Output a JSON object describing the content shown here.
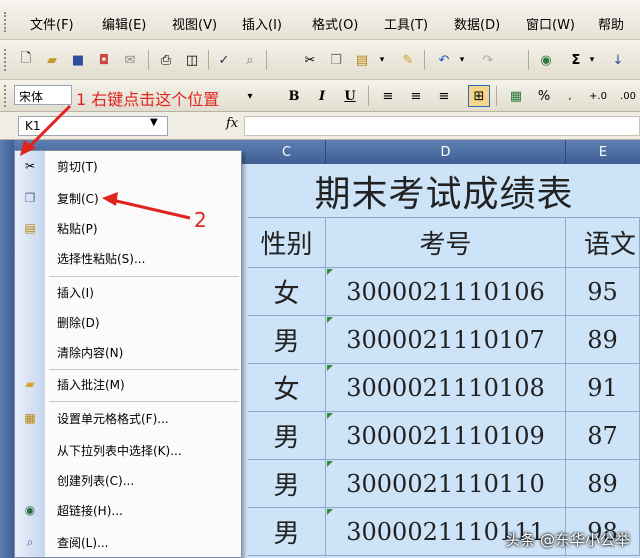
{
  "menubar": {
    "items": [
      "文件(F)",
      "编辑(E)",
      "视图(V)",
      "插入(I)",
      "格式(O)",
      "工具(T)",
      "数据(D)",
      "窗口(W)",
      "帮助"
    ]
  },
  "toolbar": {
    "font_name": "宋体",
    "percent_label": "%"
  },
  "formula_bar": {
    "cell_ref": "K1",
    "fx_label": "fx"
  },
  "columns": [
    "C",
    "D",
    "E"
  ],
  "sheet": {
    "title": "期末考试成绩表",
    "headers": [
      "性别",
      "考号",
      "语文"
    ],
    "rows": [
      [
        "女",
        "3000021110106",
        "95"
      ],
      [
        "男",
        "3000021110107",
        "89"
      ],
      [
        "女",
        "3000021110108",
        "91"
      ],
      [
        "男",
        "3000021110109",
        "87"
      ],
      [
        "男",
        "3000021110110",
        "89"
      ],
      [
        "男",
        "3000021110111",
        "98"
      ]
    ]
  },
  "context_menu": {
    "items": [
      {
        "label": "剪切(T)",
        "icon": "scissors-icon"
      },
      {
        "label": "复制(C)",
        "icon": "copy-icon"
      },
      {
        "label": "粘贴(P)",
        "icon": "paste-icon"
      },
      {
        "label": "选择性粘贴(S)...",
        "icon": ""
      },
      {
        "label": "插入(I)",
        "icon": ""
      },
      {
        "label": "删除(D)",
        "icon": ""
      },
      {
        "label": "清除内容(N)",
        "icon": ""
      },
      {
        "label": "插入批注(M)",
        "icon": "comment-icon"
      },
      {
        "label": "设置单元格格式(F)...",
        "icon": "format-cells-icon"
      },
      {
        "label": "从下拉列表中选择(K)...",
        "icon": ""
      },
      {
        "label": "创建列表(C)...",
        "icon": ""
      },
      {
        "label": "超链接(H)...",
        "icon": "hyperlink-icon"
      },
      {
        "label": "查阅(L)...",
        "icon": "research-icon"
      }
    ]
  },
  "annotations": {
    "step1": "1 右键点击这个位置",
    "step2": "2"
  },
  "watermark": "头条 @东华小公举",
  "colors": {
    "annotation_red": "#e0241f",
    "grid_bg": "#cde3f7",
    "col_header": "#4a6aa0",
    "menu_highlight": "#c1d2ee"
  }
}
